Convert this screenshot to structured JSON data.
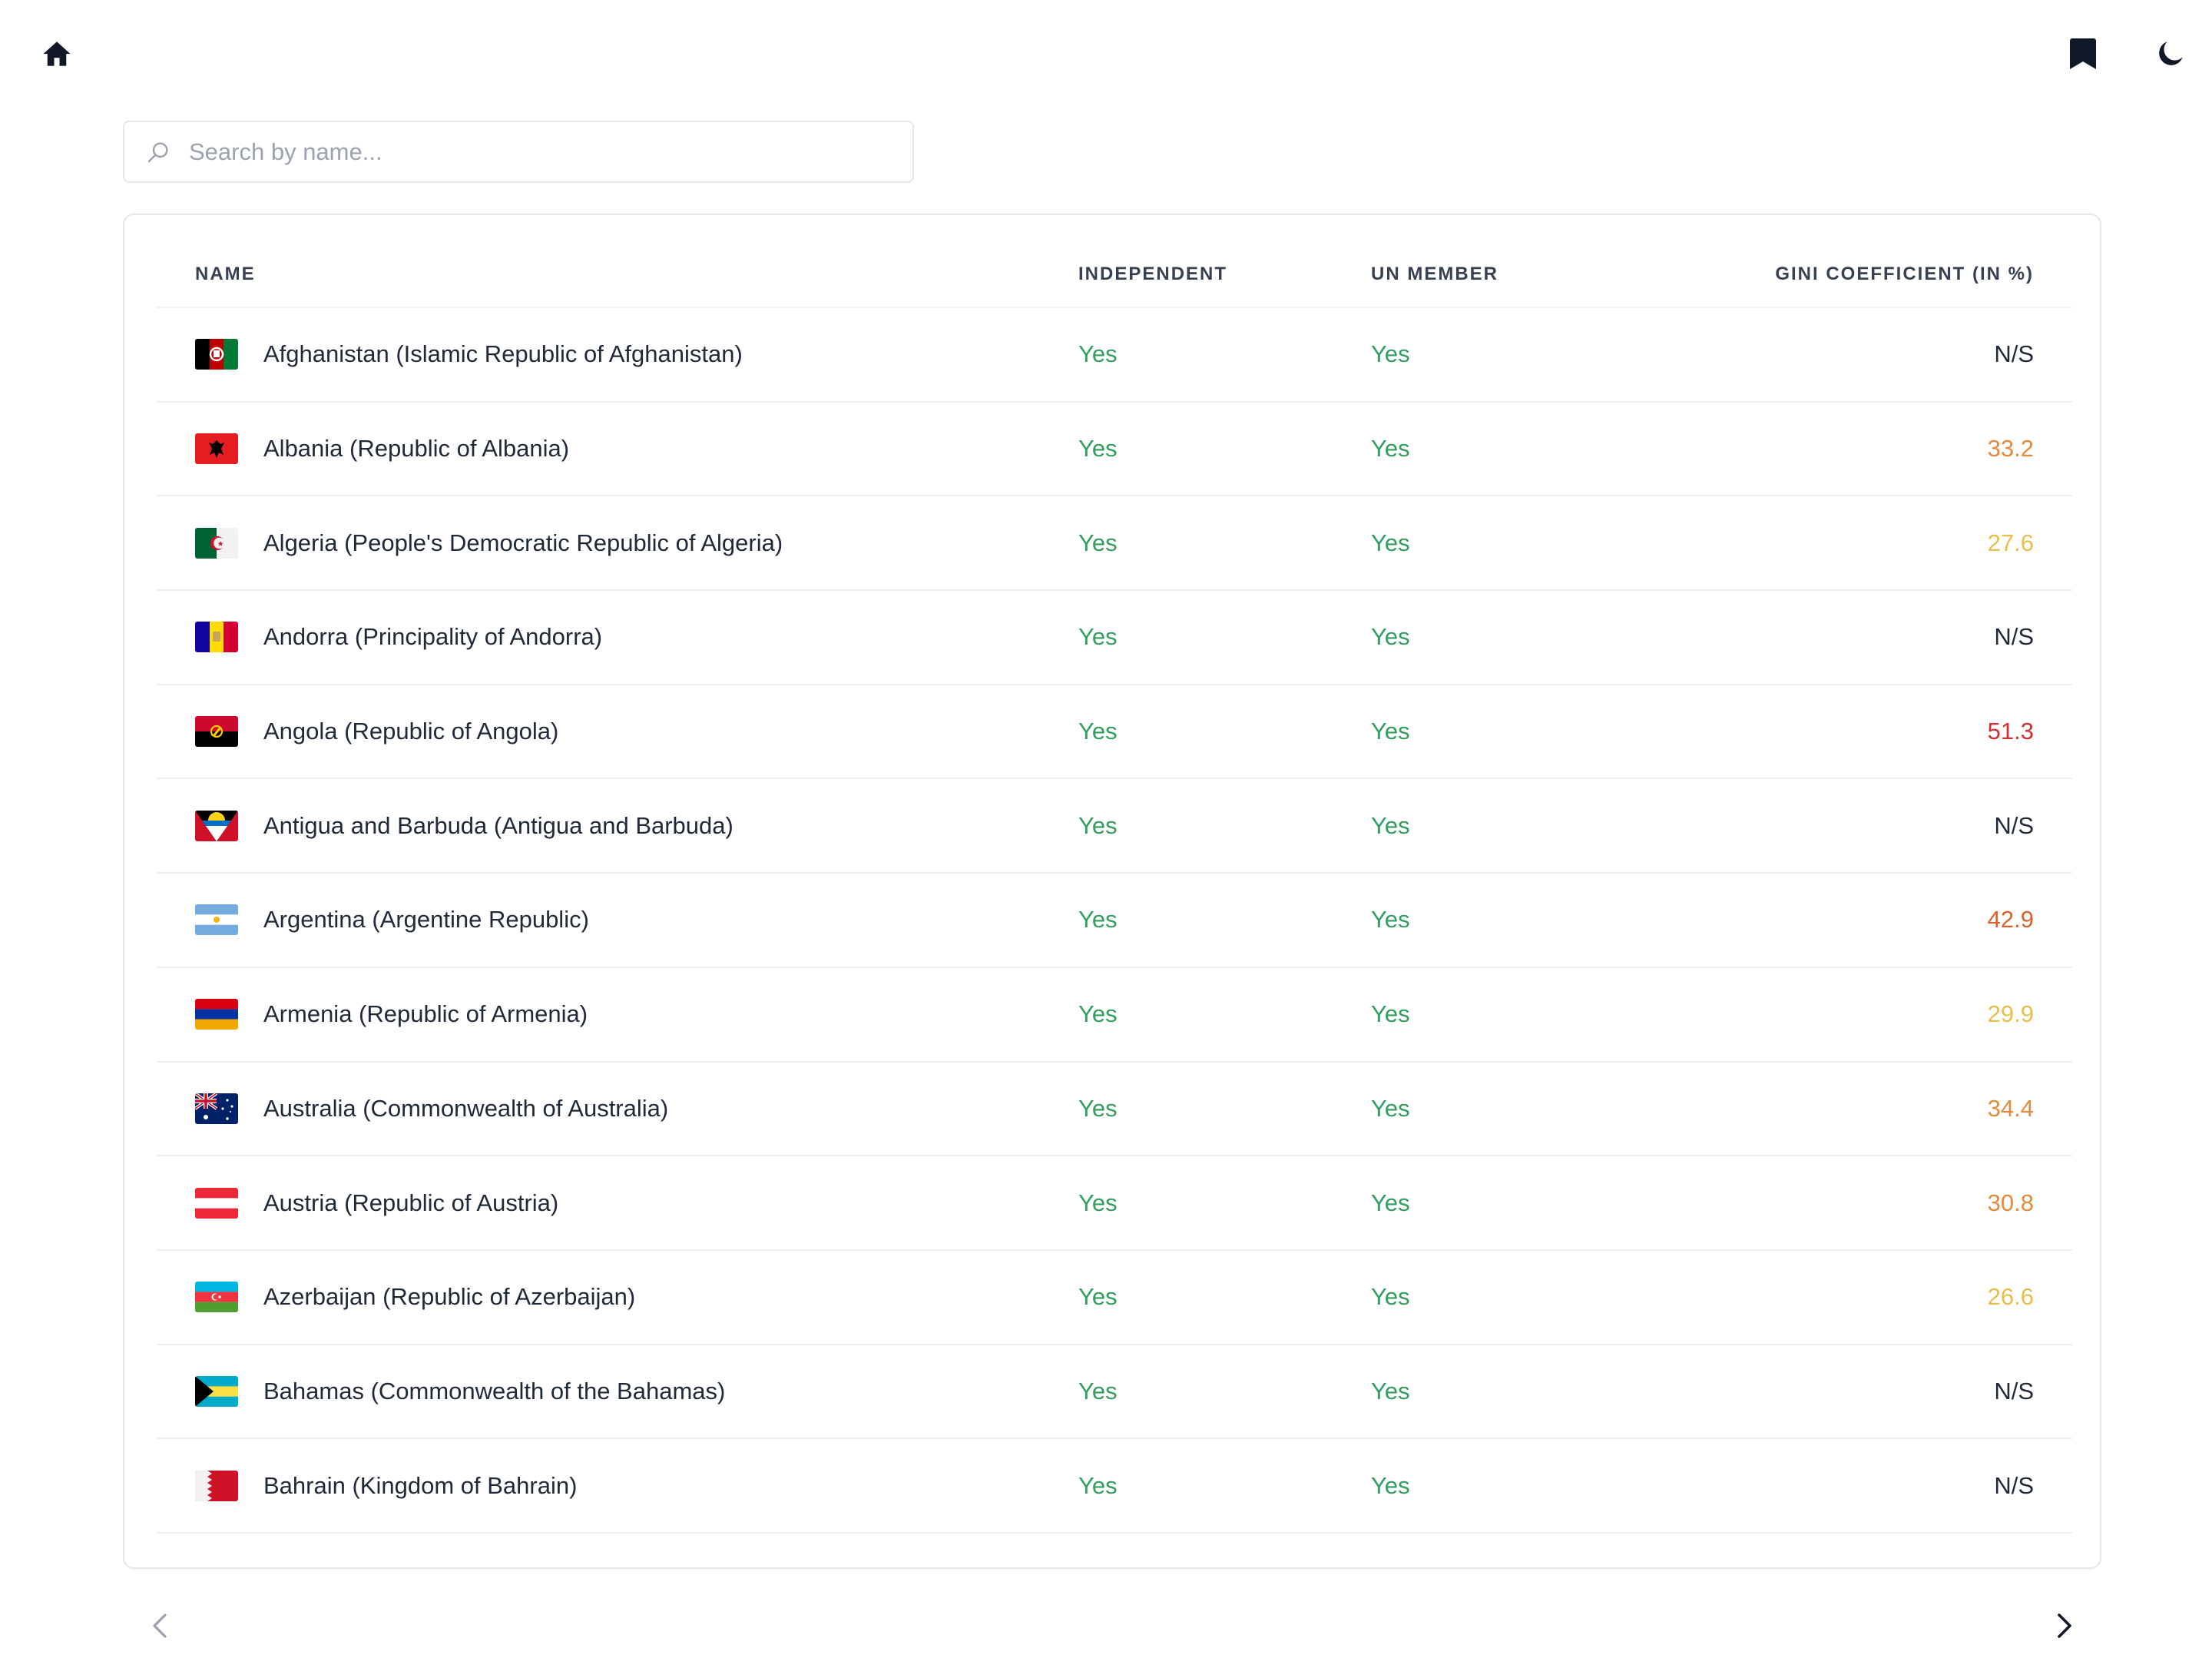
{
  "topbar": {
    "home_icon": "home-icon",
    "bookmark_icon": "bookmark-icon",
    "theme_icon": "moon-icon"
  },
  "search": {
    "placeholder": "Search by name...",
    "value": ""
  },
  "table": {
    "headers": {
      "name": "NAME",
      "independent": "INDEPENDENT",
      "un_member": "UN MEMBER",
      "gini": "GINI COEFFICIENT (IN %)"
    },
    "rows": [
      {
        "name": "Afghanistan (Islamic Republic of Afghanistan)",
        "independent": "Yes",
        "un_member": "Yes",
        "gini": "N/S",
        "gini_color": "#1f2937",
        "flag": "af"
      },
      {
        "name": "Albania (Republic of Albania)",
        "independent": "Yes",
        "un_member": "Yes",
        "gini": "33.2",
        "gini_color": "#e8893a",
        "flag": "al"
      },
      {
        "name": "Algeria (People's Democratic Republic of Algeria)",
        "independent": "Yes",
        "un_member": "Yes",
        "gini": "27.6",
        "gini_color": "#e8bf4a",
        "flag": "dz"
      },
      {
        "name": "Andorra (Principality of Andorra)",
        "independent": "Yes",
        "un_member": "Yes",
        "gini": "N/S",
        "gini_color": "#1f2937",
        "flag": "ad"
      },
      {
        "name": "Angola (Republic of Angola)",
        "independent": "Yes",
        "un_member": "Yes",
        "gini": "51.3",
        "gini_color": "#d32f2f",
        "flag": "ao"
      },
      {
        "name": "Antigua and Barbuda (Antigua and Barbuda)",
        "independent": "Yes",
        "un_member": "Yes",
        "gini": "N/S",
        "gini_color": "#1f2937",
        "flag": "ag"
      },
      {
        "name": "Argentina (Argentine Republic)",
        "independent": "Yes",
        "un_member": "Yes",
        "gini": "42.9",
        "gini_color": "#d9622b",
        "flag": "ar"
      },
      {
        "name": "Armenia (Republic of Armenia)",
        "independent": "Yes",
        "un_member": "Yes",
        "gini": "29.9",
        "gini_color": "#e8bf4a",
        "flag": "am"
      },
      {
        "name": "Australia (Commonwealth of Australia)",
        "independent": "Yes",
        "un_member": "Yes",
        "gini": "34.4",
        "gini_color": "#e8893a",
        "flag": "au"
      },
      {
        "name": "Austria (Republic of Austria)",
        "independent": "Yes",
        "un_member": "Yes",
        "gini": "30.8",
        "gini_color": "#e8893a",
        "flag": "at"
      },
      {
        "name": "Azerbaijan (Republic of Azerbaijan)",
        "independent": "Yes",
        "un_member": "Yes",
        "gini": "26.6",
        "gini_color": "#e8bf4a",
        "flag": "az"
      },
      {
        "name": "Bahamas (Commonwealth of the Bahamas)",
        "independent": "Yes",
        "un_member": "Yes",
        "gini": "N/S",
        "gini_color": "#1f2937",
        "flag": "bs"
      },
      {
        "name": "Bahrain (Kingdom of Bahrain)",
        "independent": "Yes",
        "un_member": "Yes",
        "gini": "N/S",
        "gini_color": "#1f2937",
        "flag": "bh"
      }
    ]
  },
  "pagination": {
    "prev_icon": "chevron-left-icon",
    "next_icon": "chevron-right-icon"
  },
  "colors": {
    "yes": "#2f9e5e",
    "border": "#e5e7eb",
    "icon": "#111827"
  }
}
